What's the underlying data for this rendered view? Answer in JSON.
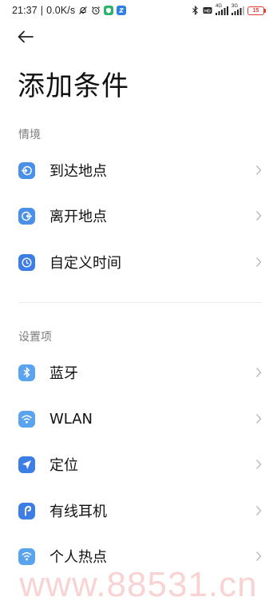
{
  "status_bar": {
    "time": "21:37",
    "separator": "|",
    "net_speed": "0.0K/s",
    "net_label_4g": "4G",
    "net_label_3g": "3G",
    "battery": "15"
  },
  "header": {
    "back_icon": "arrow-left-icon",
    "title": "添加条件"
  },
  "sections": {
    "context": {
      "title": "情境",
      "items": [
        {
          "label": "到达地点",
          "icon": "arrive-location-icon",
          "color": "#4a90e8"
        },
        {
          "label": "离开地点",
          "icon": "leave-location-icon",
          "color": "#4a90e8"
        },
        {
          "label": "自定义时间",
          "icon": "clock-icon",
          "color": "#3d7de6"
        }
      ]
    },
    "settings": {
      "title": "设置项",
      "items": [
        {
          "label": "蓝牙",
          "icon": "bluetooth-icon",
          "color": "#5aa3ee"
        },
        {
          "label": "WLAN",
          "icon": "wifi-icon",
          "color": "#5aa3ee"
        },
        {
          "label": "定位",
          "icon": "location-arrow-icon",
          "color": "#3d7de6"
        },
        {
          "label": "有线耳机",
          "icon": "headphone-icon",
          "color": "#3d7de6"
        },
        {
          "label": "个人热点",
          "icon": "hotspot-icon",
          "color": "#5aa3ee"
        }
      ]
    }
  },
  "watermark": "www.88531.cn"
}
